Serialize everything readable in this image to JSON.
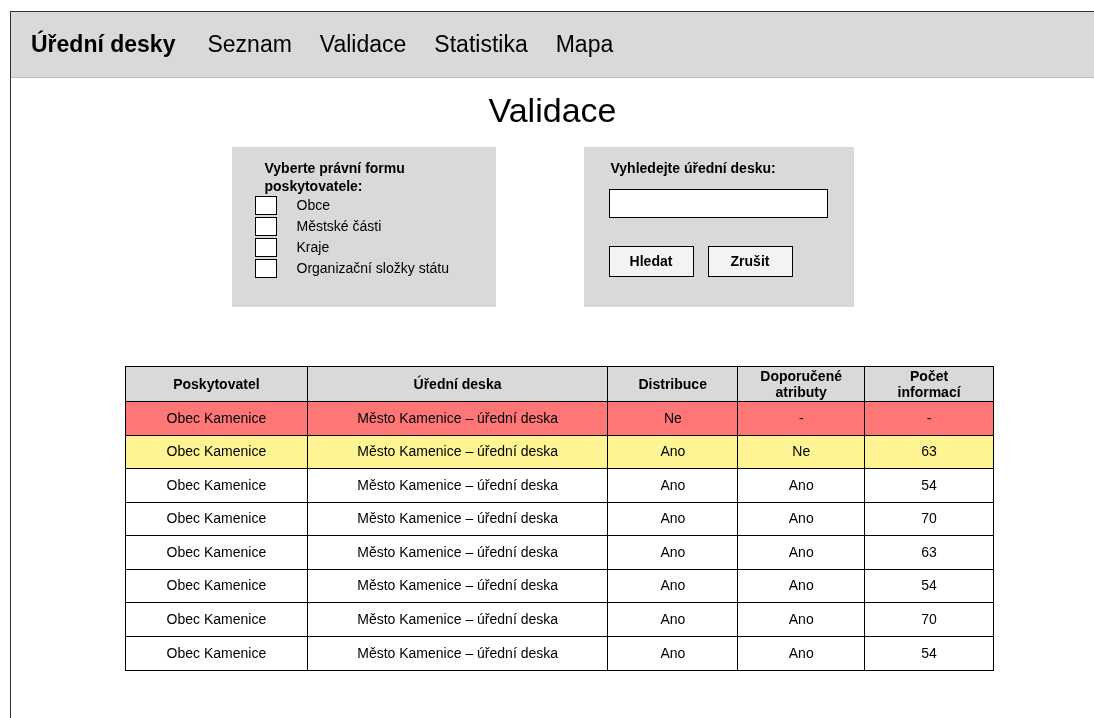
{
  "nav": {
    "brand": "Úřední desky",
    "items": [
      {
        "label": "Seznam",
        "selected": false
      },
      {
        "label": "Validace",
        "selected": false
      },
      {
        "label": "Statistika",
        "selected": false
      },
      {
        "label": "Mapa",
        "selected": false
      }
    ]
  },
  "title": "Validace",
  "filter": {
    "heading": "Vyberte právní formu poskytovatele:",
    "options": [
      {
        "label": "Obce",
        "checked": false
      },
      {
        "label": "Městské části",
        "checked": false
      },
      {
        "label": "Kraje",
        "checked": false
      },
      {
        "label": "Organizační složky státu",
        "checked": false
      }
    ]
  },
  "search": {
    "heading": "Vyhledejte úřední desku:",
    "buttons": [
      "Hledat",
      "Zrušit"
    ]
  },
  "table": {
    "columns": [
      "Poskytovatel",
      "Úřední deska",
      "Distribuce",
      "Doporučené atributy",
      "Počet informací"
    ],
    "rows": [
      {
        "color": "#ff7676",
        "cells": [
          "Obec Kamenice",
          "Město Kamenice – úřední deska",
          "Ne",
          "-",
          "-"
        ]
      },
      {
        "color": "#fff494",
        "cells": [
          "Obec Kamenice",
          "Město Kamenice – úřední deska",
          "Ano",
          "Ne",
          "63"
        ]
      },
      {
        "color": "#ffffff",
        "cells": [
          "Obec Kamenice",
          "Město Kamenice – úřední deska",
          "Ano",
          "Ano",
          "54"
        ]
      },
      {
        "color": "#ffffff",
        "cells": [
          "Obec Kamenice",
          "Město Kamenice – úřední deska",
          "Ano",
          "Ano",
          "70"
        ]
      },
      {
        "color": "#ffffff",
        "cells": [
          "Obec Kamenice",
          "Město Kamenice – úřední deska",
          "Ano",
          "Ano",
          "63"
        ]
      },
      {
        "color": "#ffffff",
        "cells": [
          "Obec Kamenice",
          "Město Kamenice – úřední deska",
          "Ano",
          "Ano",
          "54"
        ]
      },
      {
        "color": "#ffffff",
        "cells": [
          "Obec Kamenice",
          "Město Kamenice – úřední deska",
          "Ano",
          "Ano",
          "70"
        ]
      },
      {
        "color": "#ffffff",
        "cells": [
          "Obec Kamenice",
          "Město Kamenice – úřední deska",
          "Ano",
          "Ano",
          "54"
        ]
      }
    ]
  }
}
